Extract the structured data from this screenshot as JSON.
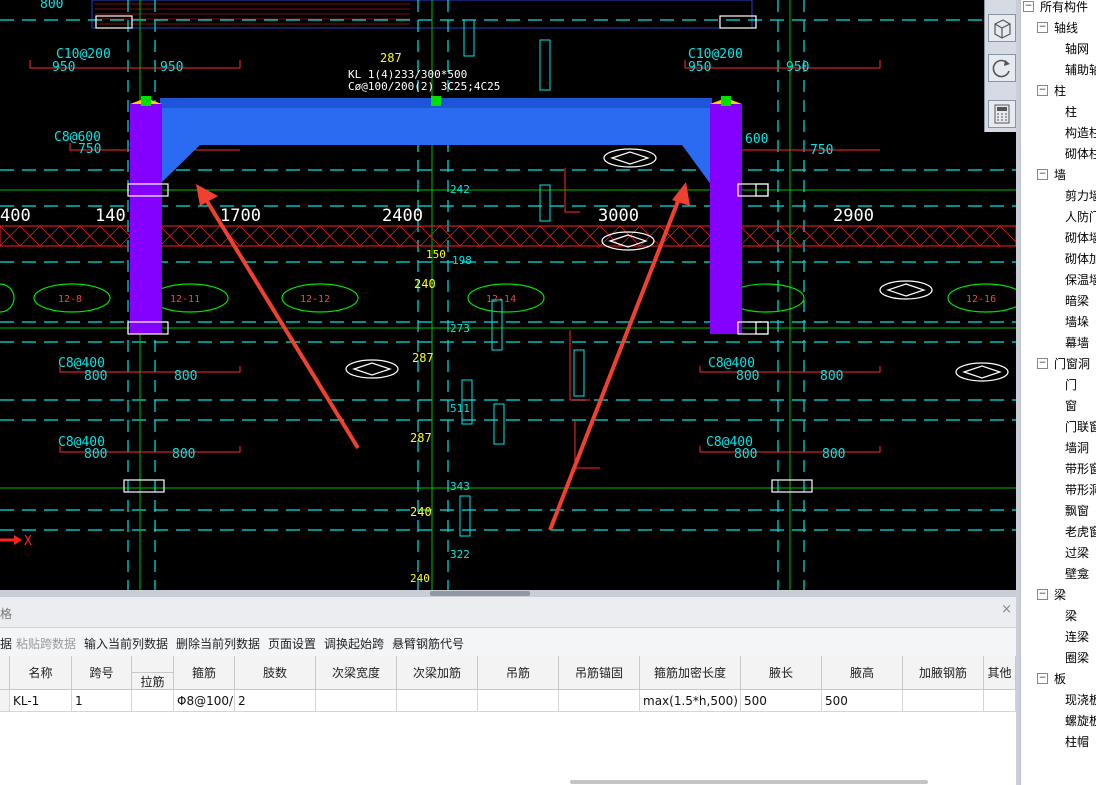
{
  "canvas": {
    "colors": {
      "bg": "#000000",
      "cyan": "#00e6e6",
      "red": "#ff2020",
      "yellow": "#ffff00",
      "green": "#00d000",
      "beam": "#2b6bf2",
      "column": "#8400ff",
      "arrow": "#f04030"
    },
    "labels": {
      "axis_x": "X",
      "dim_400": "400",
      "dim_140": "140",
      "dim_1700": "1700",
      "dim_2400": "2400",
      "dim_3000": "3000",
      "dim_2900": "2900",
      "rebar_tl": "C10@200",
      "rebar_tr": "C10@200",
      "span_950_a": "950",
      "span_950_b": "950",
      "span_950_c": "950",
      "span_950_d": "950",
      "c8_600": "C8@600",
      "n750_l": "750",
      "n750_r": "750",
      "n600_r": "600",
      "c8_400_a": "C8@400",
      "c8_400_b": "C8@400",
      "c8_400_c": "C8@400",
      "c8_400_d": "C8@400",
      "n800_1": "800",
      "n800_2": "800",
      "n800_3": "800",
      "n800_4": "800",
      "n800_5": "800",
      "n800_6": "800",
      "n800_7": "800",
      "n800_8": "800",
      "y287_a": "287",
      "y287_b": "287",
      "y287_c": "287",
      "y240_a": "240",
      "y240_b": "240",
      "e12_8": "12-8",
      "e12_11": "12-11",
      "e12_12": "12-12",
      "e12_14": "12-14",
      "e12_16": "12-16",
      "beam_note1": "KL 1(4)233/300*500",
      "beam_note2": "Cø@100/200(2) 3C25;4C25",
      "top_800": "800"
    }
  },
  "icons": {
    "view_cube": "cube-icon",
    "rotate": "rotate-icon",
    "calc": "calculator-icon"
  },
  "panel": {
    "title": "格",
    "close": "×",
    "toolbar": [
      {
        "label": "据",
        "disabled": false
      },
      {
        "label": "粘贴跨数据",
        "disabled": true
      },
      {
        "label": "输入当前列数据",
        "disabled": false
      },
      {
        "label": "删除当前列数据",
        "disabled": false
      },
      {
        "label": "页面设置",
        "disabled": false
      },
      {
        "label": "调换起始跨",
        "disabled": false
      },
      {
        "label": "悬臂钢筋代号",
        "disabled": false
      }
    ],
    "columns": [
      "名称",
      "跨号",
      "拉筋",
      "箍筋",
      "肢数",
      "次梁宽度",
      "次梁加筋",
      "吊筋",
      "吊筋锚固",
      "箍筋加密长度",
      "腋长",
      "腋高",
      "加腋钢筋",
      "其他"
    ],
    "row": {
      "name": "KL-1",
      "span": "1",
      "tie": "",
      "stirrup": "Φ8@100/",
      "legs": "2",
      "sec_width": "",
      "sec_add": "",
      "hanger": "",
      "hanger_anchor": "",
      "dense_len": "max(1.5*h,500)",
      "haunch_len": "500",
      "haunch_h": "500",
      "haunch_bar": "",
      "other": ""
    }
  },
  "tree": {
    "items": [
      {
        "label": "所有构件",
        "level": 0,
        "box": "−"
      },
      {
        "label": "轴线",
        "level": 1,
        "box": "−"
      },
      {
        "label": "轴网",
        "level": 2
      },
      {
        "label": "辅助轴线",
        "level": 2
      },
      {
        "label": "柱",
        "level": 1,
        "box": "−"
      },
      {
        "label": "柱",
        "level": 2
      },
      {
        "label": "构造柱",
        "level": 2
      },
      {
        "label": "砌体柱",
        "level": 2
      },
      {
        "label": "墙",
        "level": 1,
        "box": "−"
      },
      {
        "label": "剪力墙",
        "level": 2
      },
      {
        "label": "人防门框墙",
        "level": 2
      },
      {
        "label": "砌体墙",
        "level": 2
      },
      {
        "label": "砌体加筋",
        "level": 2
      },
      {
        "label": "保温墙",
        "level": 2
      },
      {
        "label": "暗梁",
        "level": 2
      },
      {
        "label": "墙垛",
        "level": 2
      },
      {
        "label": "幕墙",
        "level": 2
      },
      {
        "label": "门窗洞",
        "level": 1,
        "box": "−"
      },
      {
        "label": "门",
        "level": 2
      },
      {
        "label": "窗",
        "level": 2
      },
      {
        "label": "门联窗",
        "level": 2
      },
      {
        "label": "墙洞",
        "level": 2
      },
      {
        "label": "带形窗",
        "level": 2
      },
      {
        "label": "带形洞",
        "level": 2
      },
      {
        "label": "飘窗",
        "level": 2
      },
      {
        "label": "老虎窗",
        "level": 2
      },
      {
        "label": "过梁",
        "level": 2
      },
      {
        "label": "壁龛",
        "level": 2
      },
      {
        "label": "梁",
        "level": 1,
        "box": "−"
      },
      {
        "label": "梁",
        "level": 2
      },
      {
        "label": "连梁",
        "level": 2
      },
      {
        "label": "圈梁",
        "level": 2
      },
      {
        "label": "板",
        "level": 1,
        "box": "−"
      },
      {
        "label": "现浇板",
        "level": 2
      },
      {
        "label": "螺旋板",
        "level": 2
      },
      {
        "label": "柱帽",
        "level": 2
      }
    ]
  }
}
